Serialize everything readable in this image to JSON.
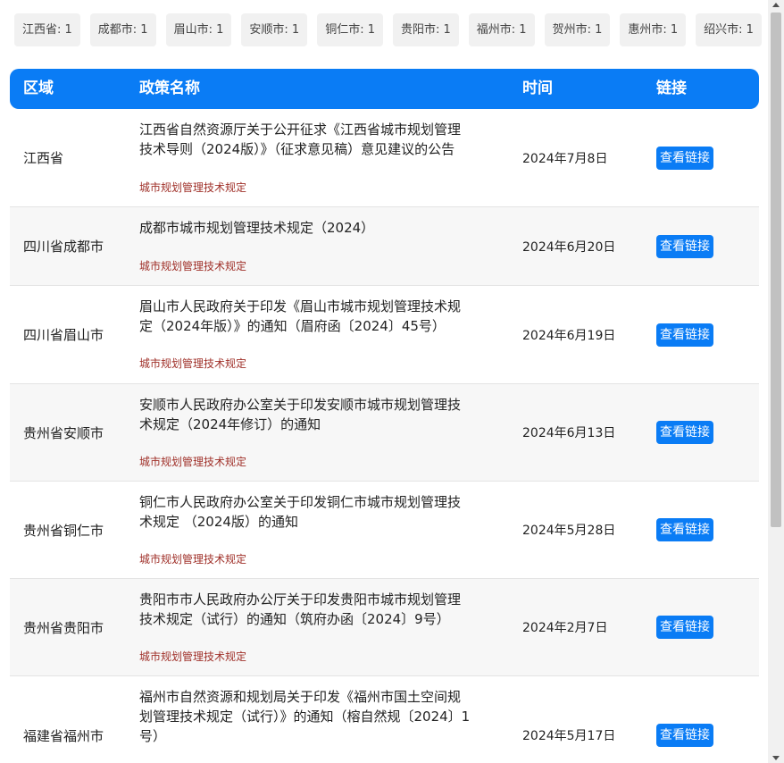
{
  "filter_tags": [
    {
      "label": "江西省: 1"
    },
    {
      "label": "成都市: 1"
    },
    {
      "label": "眉山市: 1"
    },
    {
      "label": "安顺市: 1"
    },
    {
      "label": "铜仁市: 1"
    },
    {
      "label": "贵阳市: 1"
    },
    {
      "label": "福州市: 1"
    },
    {
      "label": "贺州市: 1"
    },
    {
      "label": "惠州市: 1"
    },
    {
      "label": "绍兴市: 1"
    }
  ],
  "table": {
    "headers": {
      "region": "区域",
      "name": "政策名称",
      "time": "时间",
      "link": "链接"
    },
    "rows": [
      {
        "region": "江西省",
        "name_lines": [
          "江西省自然资源厅关于公开征求《江西省城市规划管理",
          "技术导则（2024版）》（征求意见稿）意见建议的公告"
        ],
        "category": "城市规划管理技术规定",
        "time": "2024年7月8日",
        "link_label": "查看链接"
      },
      {
        "region": "四川省成都市",
        "name_lines": [
          "成都市城市规划管理技术规定（2024）"
        ],
        "category": "城市规划管理技术规定",
        "time": "2024年6月20日",
        "link_label": "查看链接"
      },
      {
        "region": "四川省眉山市",
        "name_lines": [
          "眉山市人民政府关于印发《眉山市城市规划管理技术规",
          "定（2024年版）》的通知（眉府函〔2024〕45号）"
        ],
        "category": "城市规划管理技术规定",
        "time": "2024年6月19日",
        "link_label": "查看链接"
      },
      {
        "region": "贵州省安顺市",
        "name_lines": [
          "安顺市人民政府办公室关于印发安顺市城市规划管理技",
          "术规定（2024年修订）的通知"
        ],
        "category": "城市规划管理技术规定",
        "time": "2024年6月13日",
        "link_label": "查看链接"
      },
      {
        "region": "贵州省铜仁市",
        "name_lines": [
          "铜仁市人民政府办公室关于印发铜仁市城市规划管理技",
          "术规定 （2024版）的通知"
        ],
        "category": "城市规划管理技术规定",
        "time": "2024年5月28日",
        "link_label": "查看链接"
      },
      {
        "region": "贵州省贵阳市",
        "name_lines": [
          "贵阳市市人民政府办公厅关于印发贵阳市城市规划管理",
          "技术规定（试行）的通知（筑府办函〔2024〕9号）"
        ],
        "category": "城市规划管理技术规定",
        "time": "2024年2月7日",
        "link_label": "查看链接"
      },
      {
        "region": "福建省福州市",
        "name_lines": [
          "福州市自然资源和规划局关于印发《福州市国土空间规",
          "划管理技术规定（试行）》的通知（榕自然规〔2024〕1",
          "号）"
        ],
        "category": "",
        "time": "2024年5月17日",
        "link_label": "查看链接"
      }
    ]
  },
  "colors": {
    "header_bg": "#0a7cf5",
    "button_bg": "#0a7cf5",
    "category_text": "#a0312a",
    "tag_bg": "#f1f1f1"
  }
}
